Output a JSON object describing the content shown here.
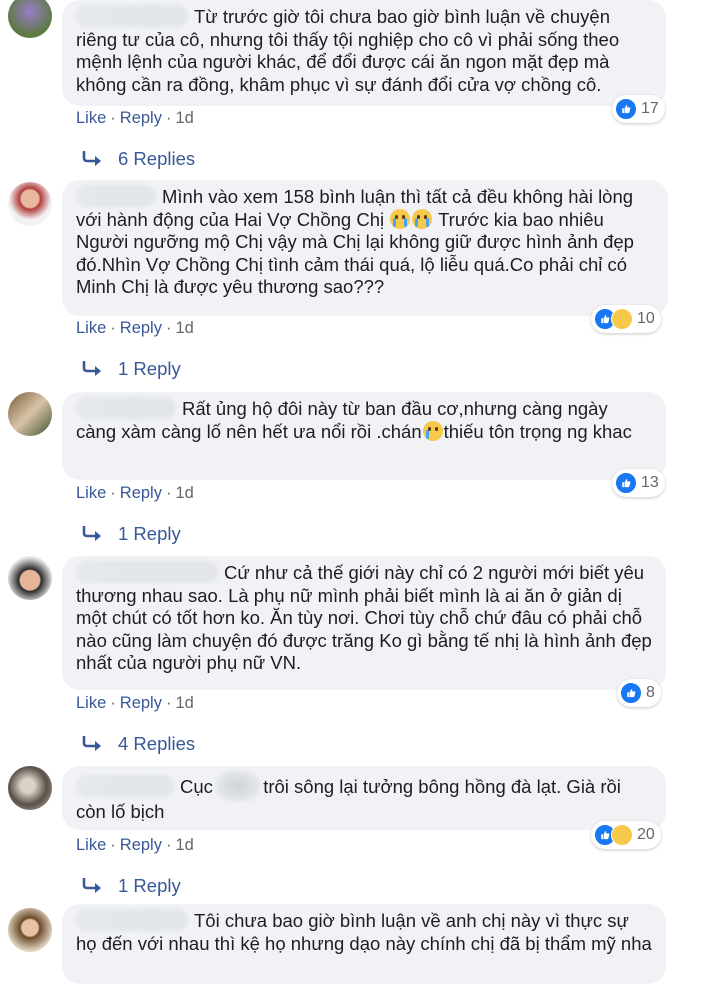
{
  "thumb_icon": "thumbs-up-icon",
  "colors": {
    "link": "#385898",
    "meta": "#65676b",
    "bubble": "#f0f2f5",
    "like_blue": "#1877f2"
  },
  "comments": [
    {
      "name_tail": "n",
      "text_before": "Từ trước giờ tôi chưa bao giờ bình luận về chuyện riêng tư của cô, nhưng tôi thấy tội nghiệp cho cô vì phải sống theo mệnh lệnh của người khác, để đổi được cái ăn ngon mặt đẹp mà không cần ra đồng, khâm phục vì sự đánh đổi cửa vợ chồng cô.",
      "reaction_count": "17",
      "like": "Like",
      "reply": "Reply",
      "time": "1d",
      "replies": "6 Replies"
    },
    {
      "name_tail": "",
      "text_before": "Mình vào xem 158 bình luận thì tất cả đều không hài lòng với hành động của Hai Vợ Chồng Chị",
      "text_after": " Trước kia bao nhiêu Người ngưỡng mộ Chị vậy mà Chị lại không giữ được hình ảnh đẹp đó.Nhìn Vợ Chồng Chị tình cảm thái quá, lộ liễu quá.Co phải chỉ có Minh Chị là được yêu thương sao???",
      "reaction_count": "10",
      "like": "Like",
      "reply": "Reply",
      "time": "1d",
      "replies": "1 Reply"
    },
    {
      "name_tail": "",
      "text_before": "Rất ủng hộ đôi này từ ban đầu cơ,nhưng càng ngày càng xàm càng lố nên hết ưa nổi rồi .chán",
      "text_after": "thiếu tôn trọng ng khac",
      "reaction_count": "13",
      "like": "Like",
      "reply": "Reply",
      "time": "1d",
      "replies": "1 Reply"
    },
    {
      "name_tail": "i",
      "text_before": "Cứ như cả thế giới này chỉ có 2 người mới biết yêu thương nhau sao. Là phụ nữ mình phải biết mình là ai ăn ở giản dị một chút có tốt hơn ko. Ăn tùy nơi. Chơi tùy chỗ chứ đâu có phải chỗ nào cũng làm chuyện đó được trăng Ko gì bằng tế nhị là hình ảnh đẹp nhất của người phụ nữ VN.",
      "reaction_count": "8",
      "like": "Like",
      "reply": "Reply",
      "time": "1d",
      "replies": "4 Replies"
    },
    {
      "name_tail": "",
      "text_before": "Cục",
      "text_after": "trôi sông lại tưởng bông hồng đà lạt. Già rồi còn lố bịch",
      "reaction_count": "20",
      "like": "Like",
      "reply": "Reply",
      "time": "1d",
      "replies": "1 Reply"
    },
    {
      "name_tail": "",
      "text_before": "Tôi chưa bao giờ bình luận về anh chị này vì thực sự họ đến với nhau thì kệ họ nhưng dạo này chính chị đã bị thẩm mỹ nha"
    }
  ]
}
